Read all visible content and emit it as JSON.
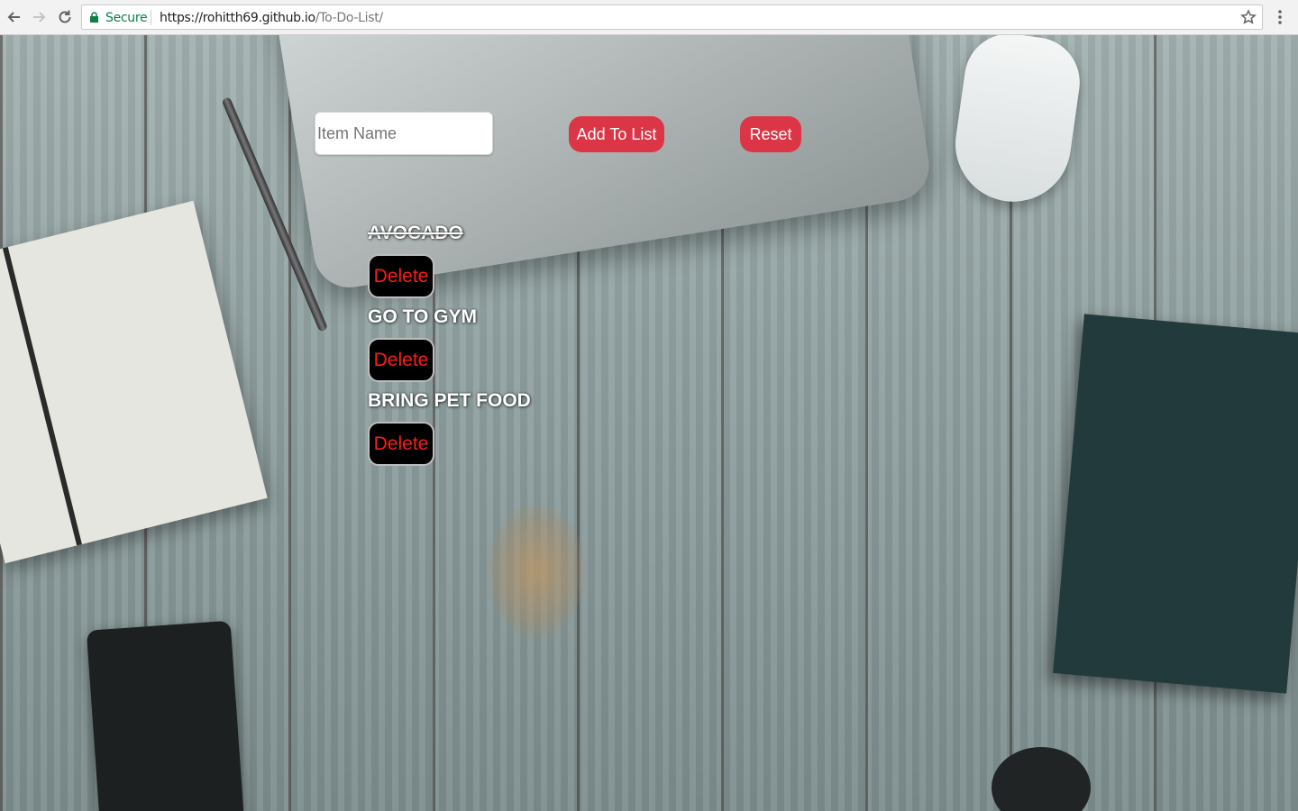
{
  "browser": {
    "secure_label": "Secure",
    "url_scheme_host": "https://rohitth69.github.io",
    "url_path": "/To-Do-List/"
  },
  "app": {
    "input_placeholder": "Item Name",
    "input_value": "",
    "add_button_label": "Add To List",
    "reset_button_label": "Reset",
    "delete_label": "Delete",
    "items": [
      {
        "text": "AVOCADO",
        "done": true
      },
      {
        "text": "GO TO GYM",
        "done": false
      },
      {
        "text": "BRING PET FOOD",
        "done": false
      }
    ]
  },
  "colors": {
    "button_red": "#dc3545",
    "delete_text": "#ff1b1b",
    "secure_green": "#0b8043"
  }
}
